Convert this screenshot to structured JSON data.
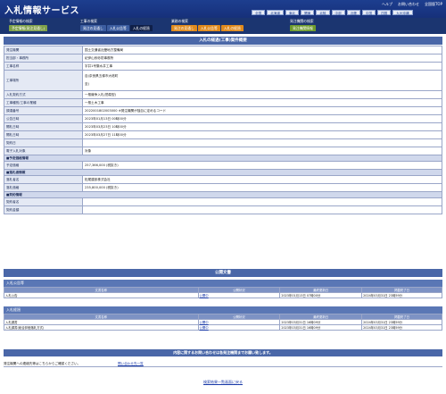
{
  "header": {
    "title": "入札情報サービス",
    "links": [
      "ヘルプ",
      "お問い合わせ",
      "全国版TOP"
    ],
    "regions": [
      "全国",
      "北海道",
      "東北",
      "関東",
      "北陸",
      "中部",
      "近畿",
      "中国",
      "四国",
      "九州沖縄"
    ]
  },
  "nav": {
    "groups": [
      {
        "head": "予定情報の検索",
        "tabs": [
          {
            "label": "予定情報(発注見通し)",
            "color": "#7fa04a"
          }
        ]
      },
      {
        "head": "工事の検索",
        "tabs": [
          {
            "label": "発注の見通し",
            "color": "#3c5da0"
          },
          {
            "label": "入札公告等",
            "color": "#3c5da0"
          },
          {
            "label": "入札の経過",
            "color": "#0f1f48"
          }
        ]
      },
      {
        "head": "業務の検索",
        "tabs": [
          {
            "label": "発注の見通し",
            "color": "#e08a1c"
          },
          {
            "label": "入札公告等",
            "color": "#e08a1c"
          },
          {
            "label": "入札の経過",
            "color": "#e08a1c"
          }
        ]
      },
      {
        "head": "発注機関の検索",
        "tabs": [
          {
            "label": "発注機関情報",
            "color": "#6e9b2c"
          }
        ]
      }
    ]
  },
  "page": {
    "heading": "入札の経過(工事)案件概要"
  },
  "details": [
    {
      "label": "発注機関",
      "value": "国土交通省近畿地方整備局"
    },
    {
      "label": "担当部・事務所",
      "value": "紀伊山系砂防事務所"
    },
    {
      "label": "工事名称",
      "value": "宇井1号集水井工事"
    },
    {
      "label": "工事場所",
      "value": "自)奈良県五條市大塔町",
      "value2": "至)",
      "tall": true
    },
    {
      "label": "入札契約方式",
      "value": "一般競争入札(簡易型)"
    },
    {
      "label": "工事種別/工事の業種",
      "value": "一般土木工事"
    },
    {
      "label": "調達番号",
      "value": "2022001802003000      ※発注機関が独自に定めるコード"
    },
    {
      "label": "公告日時",
      "value": "2023年01月13日 00時00分"
    },
    {
      "label": "開札日時",
      "value": "2023年03月23日 10時00分"
    },
    {
      "label": "開札日時",
      "value": "2023年03月27日 11時00分"
    },
    {
      "label": "契約日",
      "value": ""
    },
    {
      "label": "電子入札対象",
      "value": "対象"
    }
  ],
  "planned_price": {
    "group": "■予定価格情報",
    "rows": [
      {
        "label": "予定価格",
        "value": "257,366,000 (税抜き)"
      }
    ]
  },
  "winner": {
    "group": "■落札者情報",
    "rows": [
      {
        "label": "落札者名",
        "value": "松尾建設株式会社"
      },
      {
        "label": "落札価格",
        "value": "235,800,000 (税抜き)"
      }
    ]
  },
  "contract": {
    "group": "■契約情報",
    "rows": [
      {
        "label": "契約者名",
        "value": ""
      },
      {
        "label": "契約金額",
        "value": ""
      }
    ]
  },
  "documents": {
    "title": "公開文書",
    "columns": [
      "文書名称",
      "公開状況",
      "最終更新日",
      "掲載終了日"
    ],
    "sections": [
      {
        "name": "入札公告等",
        "rows": [
          {
            "doc": "入札公告",
            "status": "公開中",
            "updated": "2023年01月13日 07時00分",
            "end": "2024年03月31日 23時59分"
          }
        ]
      },
      {
        "name": "入札経過",
        "rows": [
          {
            "doc": "入札調書",
            "status": "公開中",
            "updated": "2023年03月31日 16時09分",
            "end": "2024年03月31日 23時59分"
          },
          {
            "doc": "入札調書(総合評価落札方式)",
            "status": "公開中",
            "updated": "2023年03月31日 16時09分",
            "end": "2024年03月31日 23時59分"
          }
        ]
      }
    ]
  },
  "notice": "内容に関するお問い合わせは各発注機関までお願い致します。",
  "contact": {
    "label": "発注機関への連絡先等はこちらからご確認ください。",
    "link": "問い合わせ先一覧"
  },
  "back_link": "検索結果一覧画面に戻る"
}
